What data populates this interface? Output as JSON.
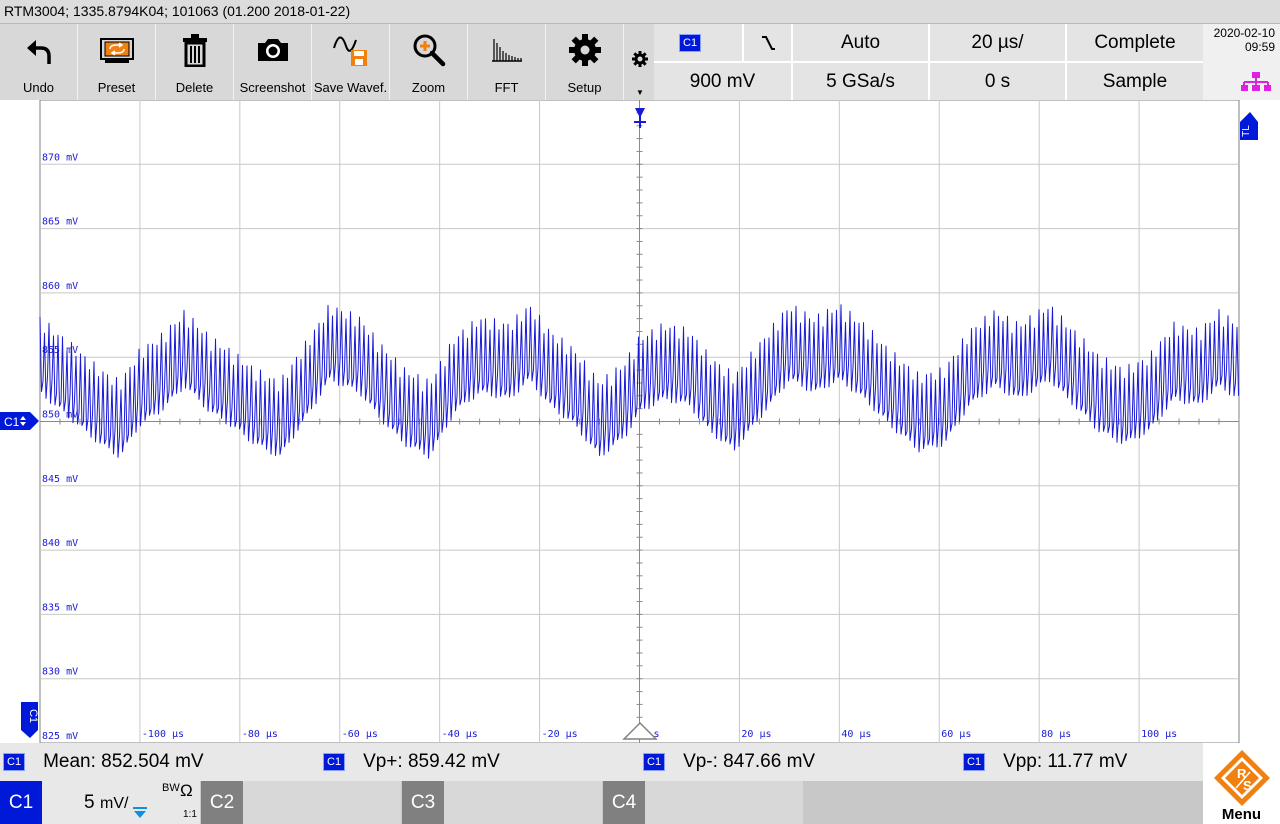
{
  "titlebar": {
    "text": "RTM3004; 1335.8794K04; 101063 (01.200 2018-01-22)"
  },
  "toolbar": {
    "items": [
      {
        "label": "Undo",
        "icon": "undo-icon"
      },
      {
        "label": "Preset",
        "icon": "preset-icon"
      },
      {
        "label": "Delete",
        "icon": "trash-icon"
      },
      {
        "label": "Screenshot",
        "icon": "camera-icon"
      },
      {
        "label": "Save Wavef.",
        "icon": "save-waveform-icon"
      },
      {
        "label": "Zoom",
        "icon": "zoom-icon"
      },
      {
        "label": "FFT",
        "icon": "fft-icon"
      },
      {
        "label": "Setup",
        "icon": "gear-icon"
      }
    ]
  },
  "settings": {
    "trigger_source": "C1",
    "trigger_slope": "falling-edge-icon",
    "trigger_mode": "Auto",
    "timebase": "20 µs/",
    "acq_state": "Complete",
    "trigger_level": "900 mV",
    "sample_rate": "5 GSa/s",
    "trigger_position": "0 s",
    "acq_mode": "Sample"
  },
  "datetime": {
    "date": "2020-02-10",
    "time": "09:59"
  },
  "plot": {
    "trigger_label": "TL",
    "channel_marker": "C1",
    "channel_side_label": "C1",
    "trace_color": "#1a1ad6"
  },
  "chart_data": {
    "type": "line",
    "x_unit": "µs",
    "y_unit": "mV",
    "xlim": [
      -120,
      120
    ],
    "ylim": [
      825,
      875
    ],
    "x_ticks": [
      "-100 µs",
      "-80 µs",
      "-60 µs",
      "-40 µs",
      "-20 µs",
      "0 s",
      "20 µs",
      "40 µs",
      "60 µs",
      "80 µs",
      "100 µs"
    ],
    "y_ticks": [
      "870 mV",
      "865 mV",
      "860 mV",
      "855 mV",
      "850 mV",
      "845 mV",
      "840 mV",
      "835 mV",
      "830 mV",
      "825 mV"
    ],
    "series": [
      {
        "x": [
          -120,
          -114,
          -108,
          -104,
          -100,
          -96,
          -91,
          -86,
          -82,
          -77,
          -72,
          -66,
          -62,
          -56,
          -52,
          -47,
          -42,
          -37,
          -32,
          -26,
          -22,
          -18,
          -13,
          -8,
          -3,
          0,
          5,
          10,
          14,
          19,
          24,
          30,
          35,
          40,
          45,
          50,
          56,
          61,
          66,
          71,
          76,
          82,
          87,
          92,
          97,
          102,
          107,
          112,
          116,
          120
        ],
        "y": [
          853.5,
          851.5,
          849.5,
          848.5,
          851,
          852,
          854,
          852,
          851,
          849.5,
          848.5,
          852,
          854.5,
          853.5,
          851.5,
          849.5,
          848.5,
          852,
          853.5,
          853,
          854.5,
          852.5,
          851,
          848.5,
          850,
          852,
          853,
          852.5,
          850.5,
          849,
          851.5,
          854.5,
          853.5,
          854.5,
          853,
          851,
          849,
          849.5,
          852.5,
          854,
          853,
          854.5,
          852.5,
          850.5,
          849.5,
          850.5,
          853,
          852.5,
          854,
          853
        ]
      }
    ]
  },
  "measurements": [
    {
      "source": "C1",
      "text": "Mean: 852.504 mV"
    },
    {
      "source": "C1",
      "text": "Vp+: 859.42 mV"
    },
    {
      "source": "C1",
      "text": "Vp-: 847.66 mV"
    },
    {
      "source": "C1",
      "text": "Vpp: 11.77 mV"
    }
  ],
  "channels": {
    "c1": {
      "label": "C1",
      "scale": "5",
      "scale_unit": "mV/",
      "bw": "BW",
      "impedance": "Ω",
      "probe": "1:1",
      "color": "#0018d8"
    },
    "c2": {
      "label": "C2"
    },
    "c3": {
      "label": "C3"
    },
    "c4": {
      "label": "C4"
    }
  },
  "menu": {
    "label": "Menu",
    "logo": "rohde-schwarz-logo"
  }
}
